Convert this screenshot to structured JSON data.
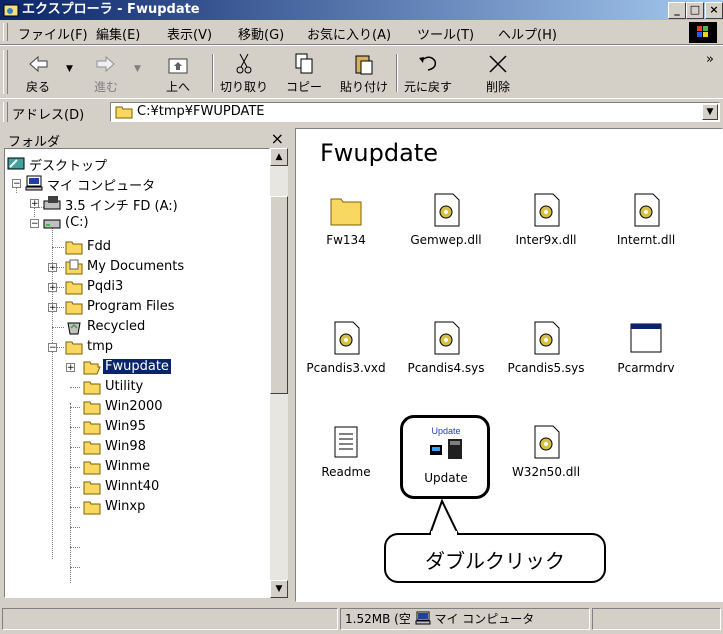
{
  "window": {
    "title": "エクスプローラ - Fwupdate"
  },
  "menu": [
    "ファイル(F)",
    "編集(E)",
    "表示(V)",
    "移動(G)",
    "お気に入り(A)",
    "ツール(T)",
    "ヘルプ(H)"
  ],
  "toolbar": {
    "back": "戻る",
    "forward": "進む",
    "up": "上へ",
    "cut": "切り取り",
    "copy": "コピー",
    "paste": "貼り付け",
    "undo": "元に戻す",
    "delete": "削除",
    "more": "»"
  },
  "address": {
    "label": "アドレス(D)",
    "value": "C:¥tmp¥FWUPDATE"
  },
  "folders": {
    "title": "フォルダ",
    "close": "×",
    "nodes": [
      "デスクトップ",
      "マイ コンピュータ",
      "3.5 インチ FD (A:)",
      "(C:)",
      "Fdd",
      "My Documents",
      "Pqdi3",
      "Program Files",
      "Recycled",
      "tmp",
      "Fwupdate",
      "Utility",
      "Win2000",
      "Win95",
      "Win98",
      "Winme",
      "Winnt40",
      "Winxp"
    ]
  },
  "content": {
    "title": "Fwupdate",
    "files": [
      "Fw134",
      "Gemwep.dll",
      "Inter9x.dll",
      "Internt.dll",
      "Pcandis3.vxd",
      "Pcandis4.sys",
      "Pcandis5.sys",
      "Pcarmdrv",
      "Readme",
      "Update",
      "W32n50.dll"
    ],
    "update_icon_text": "Update"
  },
  "annotation": {
    "callout": "ダブルクリック"
  },
  "status": {
    "size": "1.52MB",
    "space_hint": "(空",
    "location": "マイ コンピュータ"
  },
  "colors": {
    "title_active": "#0a246a",
    "selection": "#0a246a",
    "folder": "#f8d860"
  }
}
